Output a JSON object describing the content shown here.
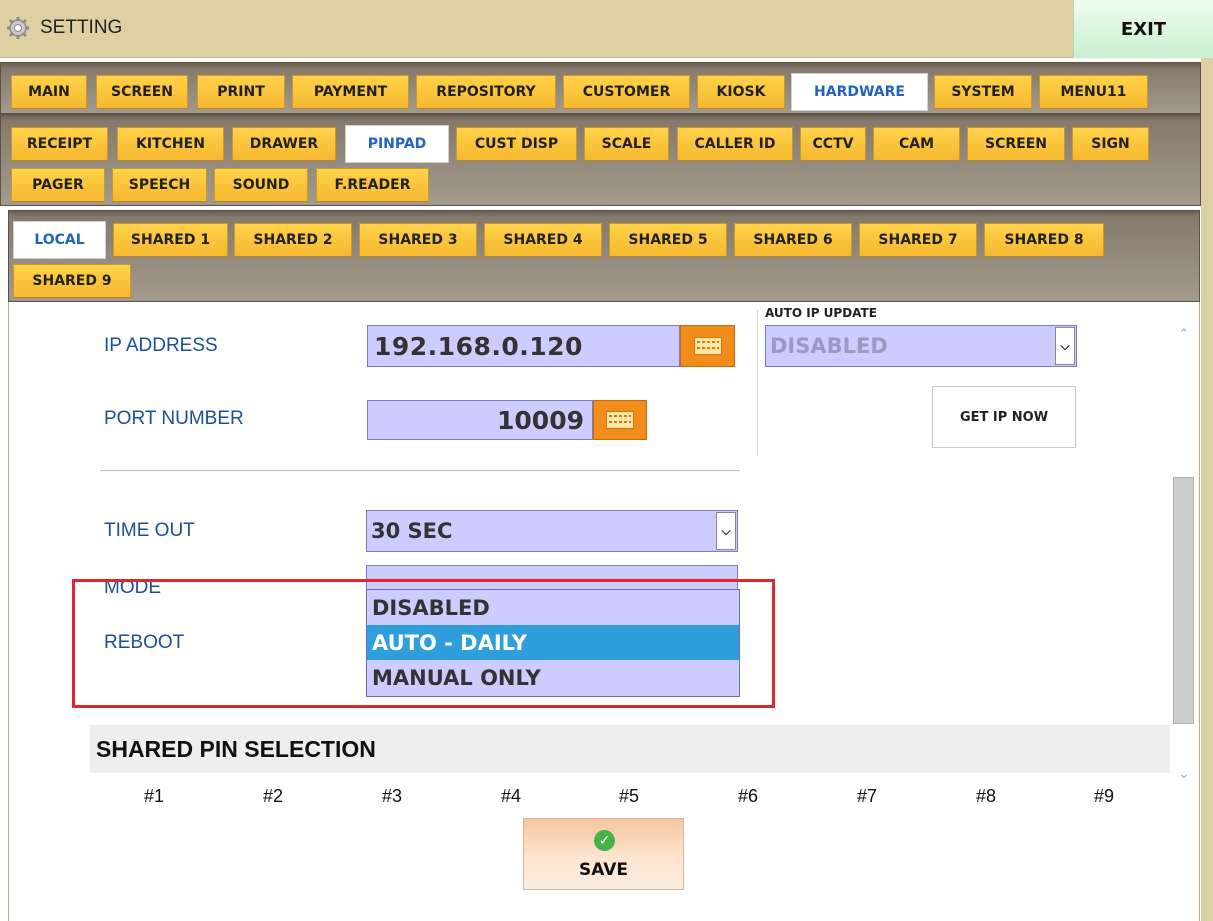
{
  "window": {
    "title": "SETTING",
    "exit_label": "EXIT"
  },
  "tabs_main": [
    "MAIN",
    "SCREEN",
    "PRINT",
    "PAYMENT",
    "REPOSITORY",
    "CUSTOMER",
    "KIOSK",
    "HARDWARE",
    "SYSTEM",
    "MENU11"
  ],
  "tabs_hardware": [
    "RECEIPT",
    "KITCHEN",
    "DRAWER",
    "PINPAD",
    "CUST DISP",
    "SCALE",
    "CALLER ID",
    "CCTV",
    "CAM",
    "SCREEN",
    "SIGN",
    "PAGER",
    "SPEECH",
    "SOUND",
    "F.READER"
  ],
  "tabs_location": [
    "LOCAL",
    "SHARED 1",
    "SHARED 2",
    "SHARED 3",
    "SHARED 4",
    "SHARED 5",
    "SHARED 6",
    "SHARED 7",
    "SHARED 8",
    "SHARED 9"
  ],
  "active_tabs": {
    "main": "HARDWARE",
    "hardware": "PINPAD",
    "location": "LOCAL"
  },
  "form": {
    "ip_address": {
      "label": "IP ADDRESS",
      "value": "192.168.0.120"
    },
    "port_number": {
      "label": "PORT NUMBER",
      "value": "10009"
    },
    "auto_ip_update": {
      "label": "AUTO IP UPDATE",
      "value": "DISABLED"
    },
    "get_ip_now": "GET IP NOW",
    "time_out": {
      "label": "TIME OUT",
      "value": "30 SEC"
    },
    "mode": {
      "label": "MODE"
    },
    "reboot": {
      "label": "REBOOT",
      "options": [
        "DISABLED",
        "AUTO - DAILY",
        "MANUAL ONLY"
      ],
      "selected": "AUTO - DAILY"
    }
  },
  "shared_pin": {
    "title": "SHARED PIN SELECTION",
    "pins": [
      "#1",
      "#2",
      "#3",
      "#4",
      "#5",
      "#6",
      "#7",
      "#8",
      "#9"
    ]
  },
  "save_label": "SAVE",
  "colors": {
    "tab_bg": "#f6b82f",
    "active_tab_text": "#1f64c0",
    "field_bg": "#ccccff",
    "selected_option": "#2f9fdb",
    "highlight_box": "#e0262f",
    "label_text": "#1b4f9c"
  }
}
